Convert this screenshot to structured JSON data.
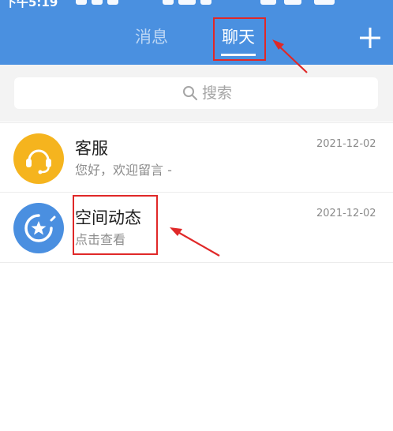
{
  "status_bar": {
    "time": "下午5:19"
  },
  "header": {
    "tabs": [
      {
        "label": "消息"
      },
      {
        "label": "聊天"
      }
    ],
    "plus_icon": "plus-icon"
  },
  "search": {
    "placeholder": "搜索",
    "icon": "search-icon"
  },
  "conversations": [
    {
      "name": "客服",
      "preview": "您好，欢迎留言 -",
      "time": "2021-12-02",
      "avatar_icon": "headset-icon",
      "avatar_color": "#f5b41e"
    },
    {
      "name": "空间动态",
      "preview": "点击查看",
      "time": "2021-12-02",
      "avatar_icon": "star-ring-icon",
      "avatar_color": "#4a8fe0"
    }
  ],
  "colors": {
    "header_bg": "#4a90e0",
    "annotation_red": "#e02828"
  }
}
